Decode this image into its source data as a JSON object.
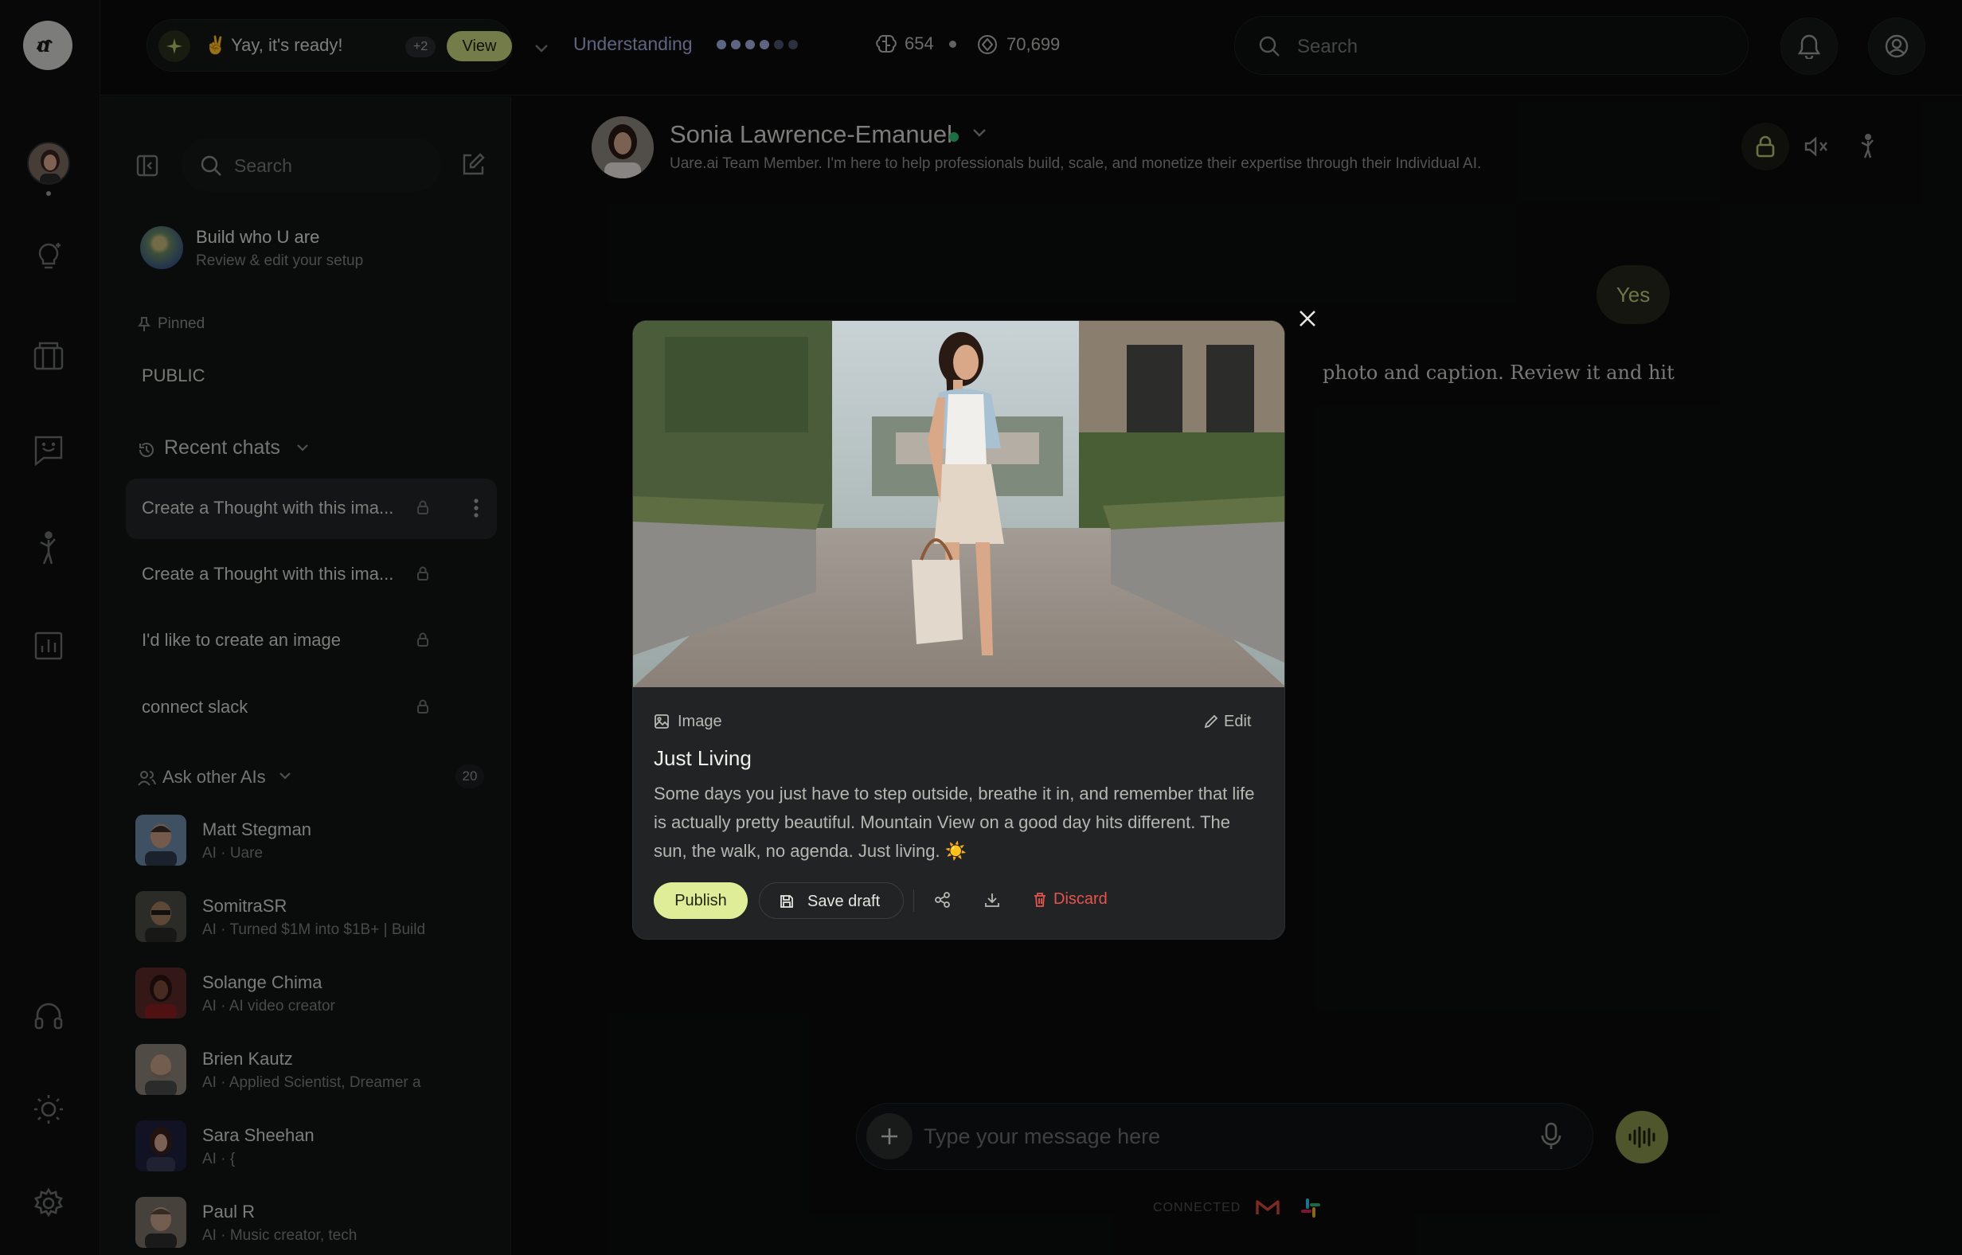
{
  "topbar": {
    "ready_text": "✌️ Yay, it's ready!",
    "ready_count": "+2",
    "view_label": "View",
    "understanding_label": "Understanding",
    "understanding_level": "4 of 6",
    "stat_1": "654",
    "stat_2": "70,699",
    "search_placeholder": "Search"
  },
  "sidebar": {
    "search_placeholder": "Search",
    "build_title": "Build who U are",
    "build_subtitle": "Review & edit your setup",
    "pinned_label": "Pinned",
    "public_label": "PUBLIC",
    "recent_label": "Recent chats",
    "chats": [
      {
        "label": "Create a Thought with this ima..."
      },
      {
        "label": "Create a Thought with this ima..."
      },
      {
        "label": "I'd like to create an image"
      },
      {
        "label": "connect slack"
      }
    ],
    "ask_label": "Ask other AIs",
    "ask_count": "20",
    "people": [
      {
        "name": "Matt Stegman",
        "desc": "AI · Uare"
      },
      {
        "name": "SomitraSR",
        "desc": "AI · Turned $1M into $1B+ | Build"
      },
      {
        "name": "Solange Chima",
        "desc": "AI · AI video creator"
      },
      {
        "name": "Brien Kautz",
        "desc": "AI · Applied Scientist, Dreamer a"
      },
      {
        "name": "Sara Sheehan",
        "desc": "AI · {"
      },
      {
        "name": "Paul R",
        "desc": "AI · Music creator, tech"
      }
    ]
  },
  "chat": {
    "agent_name": "Sonia Lawrence-Emanuel",
    "agent_desc": "Uare.ai Team Member. I'm here to help professionals build, scale, and monetize their expertise through their Individual AI.",
    "user_message": "Yes",
    "bot_text_visible": "photo and caption. Review it and hit",
    "composer_placeholder": "Type your message here",
    "connected_label": "CONNECTED"
  },
  "modal": {
    "type_label": "Image",
    "edit_label": "Edit",
    "title": "Just Living",
    "caption": "Some days you just have to step outside, breathe it in, and remember that life is actually pretty beautiful. Mountain View on a good day hits different. The sun, the walk, no agenda. Just living. ☀️",
    "publish_label": "Publish",
    "save_label": "Save draft",
    "discard_label": "Discard"
  },
  "colors": {
    "accent": "#dfed98",
    "accent_dark": "#89944c",
    "understanding": "#a2aede",
    "discard": "#e5544d",
    "online": "#2fbf6e"
  },
  "icons": [
    "logo-icon",
    "ideas-icon",
    "library-icon",
    "chat-icon",
    "action-icon",
    "analytics-icon",
    "headphones-icon",
    "theme-icon",
    "settings-icon",
    "bell-icon",
    "account-icon",
    "search-icon",
    "sidebar-toggle-icon",
    "compose-icon",
    "pin-icon",
    "history-icon",
    "lock-icon",
    "more-icon",
    "people-icon",
    "mute-icon",
    "plus-icon",
    "mic-icon",
    "voice-icon",
    "gmail-icon",
    "slack-icon",
    "image-icon",
    "pencil-icon",
    "save-icon",
    "share-icon",
    "download-icon",
    "trash-icon",
    "close-icon"
  ]
}
